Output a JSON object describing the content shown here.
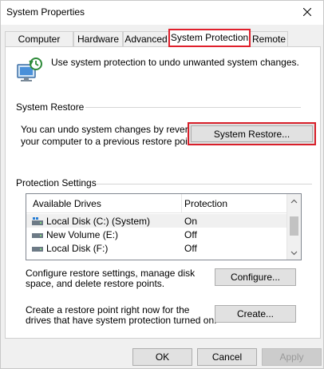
{
  "window": {
    "title": "System Properties"
  },
  "tabs": [
    {
      "label": "Computer Name"
    },
    {
      "label": "Hardware"
    },
    {
      "label": "Advanced"
    },
    {
      "label": "System Protection"
    },
    {
      "label": "Remote"
    }
  ],
  "intro": {
    "text": "Use system protection to undo unwanted system changes."
  },
  "system_restore": {
    "section_label": "System Restore",
    "text": "You can undo system changes by reverting your computer to a previous restore point.",
    "button_label": "System Restore..."
  },
  "protection": {
    "section_label": "Protection Settings",
    "columns": [
      "Available Drives",
      "Protection"
    ],
    "drives": [
      {
        "name": "Local Disk (C:) (System)",
        "protection": "On",
        "icon": "system-drive-icon"
      },
      {
        "name": "New Volume (E:)",
        "protection": "Off",
        "icon": "drive-icon"
      },
      {
        "name": "Local Disk (F:)",
        "protection": "Off",
        "icon": "drive-icon"
      }
    ]
  },
  "configure": {
    "text": "Configure restore settings, manage disk space, and delete restore points.",
    "button_label": "Configure..."
  },
  "create": {
    "text": "Create a restore point right now for the drives that have system protection turned on.",
    "button_label": "Create..."
  },
  "footer": {
    "ok_label": "OK",
    "cancel_label": "Cancel",
    "apply_label": "Apply"
  },
  "colors": {
    "highlight": "#d81f2a",
    "window_bg": "#f0f0f0",
    "panel_bg": "#ffffff"
  }
}
